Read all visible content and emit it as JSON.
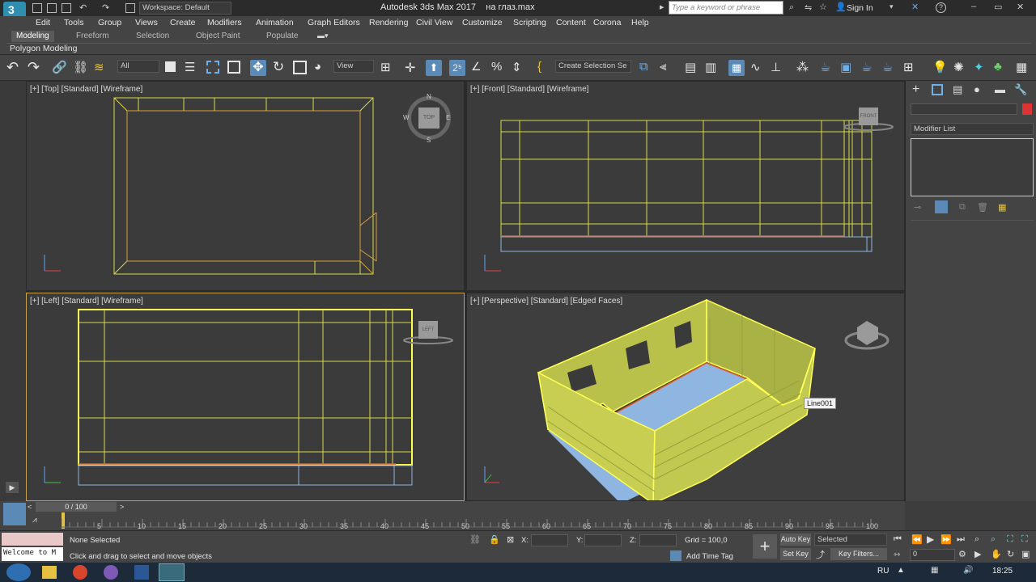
{
  "title": {
    "app_title": "Autodesk 3ds Max 2017",
    "file_name": "на глаз.max",
    "workspace": "Workspace: Default",
    "search_placeholder": "Type a keyword or phrase",
    "sign_in": "Sign In"
  },
  "menu": [
    "Edit",
    "Tools",
    "Group",
    "Views",
    "Create",
    "Modifiers",
    "Animation",
    "Graph Editors",
    "Rendering",
    "Civil View",
    "Customize",
    "Scripting",
    "Content",
    "Corona",
    "Help"
  ],
  "ribbon": {
    "tabs": [
      "Modeling",
      "Freeform",
      "Selection",
      "Object Paint",
      "Populate"
    ],
    "sub_label": "Polygon Modeling"
  },
  "toolbar": {
    "filter_value": "All",
    "coord_value": "View",
    "selection_set_value": "Create Selection Se"
  },
  "viewports": {
    "top": "[+] [Top] [Standard] [Wireframe]",
    "front": "[+] [Front] [Standard] [Wireframe]",
    "left": "[+] [Left] [Standard] [Wireframe]",
    "perspective": "[+] [Perspective] [Standard] [Edged Faces]",
    "tooltip": "Line001",
    "compass_top_cube": "TOP",
    "compass_front_cube": "FRONT",
    "compass_left_cube": "LEFT",
    "compass_w": "W",
    "compass_e": "E",
    "compass_n": "N",
    "compass_s": "S"
  },
  "command_panel": {
    "modifier_list": "Modifier List"
  },
  "timeline": {
    "frame_counter": "0 / 100",
    "ticks": [
      "5",
      "10",
      "15",
      "20",
      "25",
      "30",
      "35",
      "40",
      "45",
      "50",
      "55",
      "60",
      "65",
      "70",
      "75",
      "80",
      "85",
      "90",
      "95",
      "100"
    ]
  },
  "status": {
    "selection": "None Selected",
    "prompt": "Click and drag to select and move objects",
    "listener": "Welcome to M",
    "x_label": "X:",
    "y_label": "Y:",
    "z_label": "Z:",
    "grid": "Grid = 100,0",
    "add_time_tag": "Add Time Tag",
    "auto_key": "Auto Key",
    "set_key": "Set Key",
    "selected_dropdown": "Selected",
    "key_filters": "Key Filters...",
    "frame_field": "0"
  },
  "taskbar": {
    "lang": "RU",
    "clock": "18:25"
  },
  "colors": {
    "wire_yellow": "#d8d84a",
    "wire_orange": "#d8a23a",
    "selected_yellow": "#ffff55",
    "floor_blue": "#8fb6e0",
    "accent_blue": "#5b8ab6"
  }
}
